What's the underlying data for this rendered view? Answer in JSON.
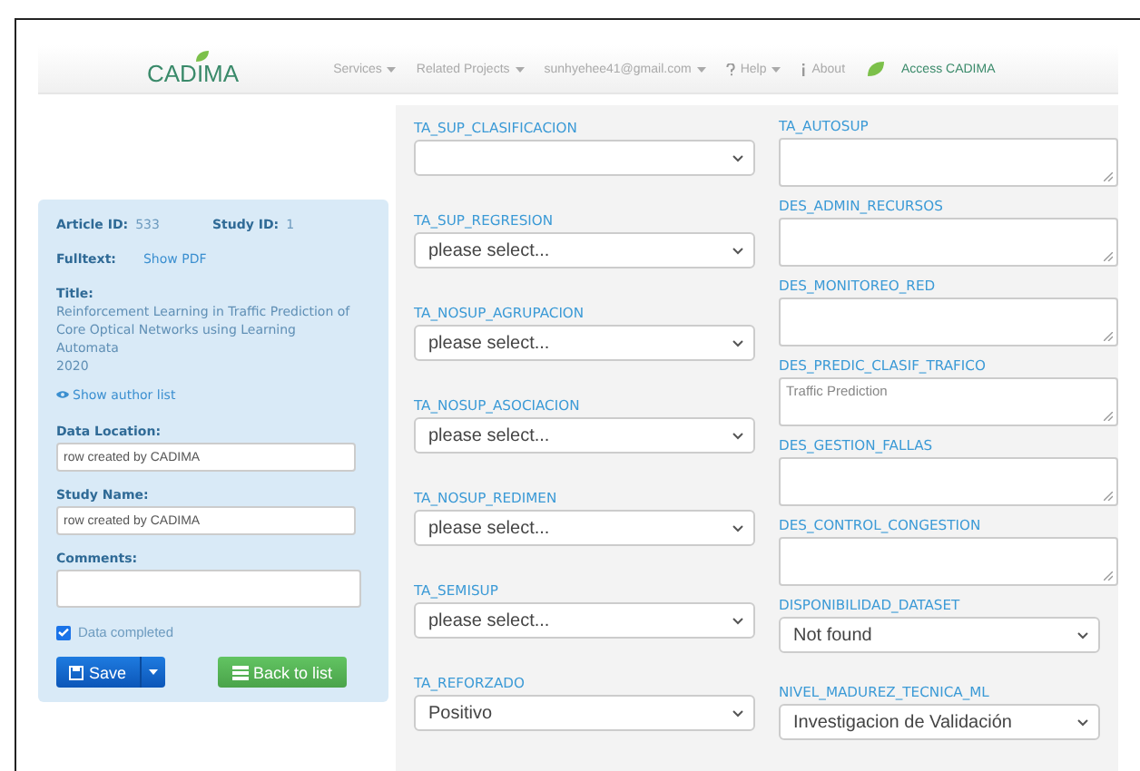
{
  "nav": {
    "brand": "CADIMA",
    "items": [
      {
        "label": "Services",
        "kind": "dropdown"
      },
      {
        "label": "Related Projects",
        "kind": "dropdown"
      },
      {
        "label": "sunhyehee41@gmail.com",
        "kind": "dropdown"
      },
      {
        "label": "Help",
        "kind": "help"
      },
      {
        "label": "About",
        "kind": "about"
      },
      {
        "label": "Access CADIMA",
        "kind": "access"
      }
    ]
  },
  "article": {
    "article_id_label": "Article ID:",
    "article_id": "533",
    "study_id_label": "Study ID:",
    "study_id": "1",
    "fulltext_label": "Fulltext:",
    "fulltext_link": "Show PDF",
    "title_label": "Title:",
    "title": "Reinforcement Learning in Traffic Prediction of Core Optical Networks using Learning Automata",
    "year": "2020",
    "author_link": "Show author list",
    "fields": [
      {
        "label": "Data Location:",
        "value": "row created by CADIMA",
        "kind": "input"
      },
      {
        "label": "Study Name:",
        "value": "row created by CADIMA",
        "kind": "input"
      },
      {
        "label": "Comments:",
        "kind": "textarea"
      }
    ],
    "data_completed": {
      "label": "Data completed",
      "checked": true
    },
    "buttons": [
      {
        "label": "Save",
        "kind": "save"
      },
      {
        "label": "Back to list",
        "kind": "back"
      }
    ]
  },
  "columns": [
    [
      {
        "label": "TA_SUP_CLASIFICACION",
        "kind": "select"
      },
      {
        "label": "TA_SUP_REGRESION",
        "kind": "select",
        "value": "please select..."
      },
      {
        "label": "TA_NOSUP_AGRUPACION",
        "kind": "select",
        "value": "please select..."
      },
      {
        "label": "TA_NOSUP_ASOCIACION",
        "kind": "select",
        "value": "please select..."
      },
      {
        "label": "TA_NOSUP_REDIMEN",
        "kind": "select",
        "value": "please select..."
      },
      {
        "label": "TA_SEMISUP",
        "kind": "select",
        "value": "please select..."
      },
      {
        "label": "TA_REFORZADO",
        "kind": "select",
        "value": "Positivo"
      }
    ],
    [
      {
        "label": "TA_AUTOSUP",
        "kind": "textarea"
      },
      {
        "label": "DES_ADMIN_RECURSOS",
        "kind": "textarea"
      },
      {
        "label": "DES_MONITOREO_RED",
        "kind": "textarea"
      },
      {
        "label": "DES_PREDIC_CLASIF_TRAFICO",
        "kind": "textarea",
        "value": "Traffic Prediction"
      },
      {
        "label": "DES_GESTION_FALLAS",
        "kind": "textarea"
      },
      {
        "label": "DES_CONTROL_CONGESTION",
        "kind": "textarea"
      },
      {
        "label": "DISPONIBILIDAD_DATASET",
        "kind": "select",
        "value": "Not found"
      },
      {
        "label": "NIVEL_MADUREZ_TECNICA_ML",
        "kind": "select",
        "value": "Investigacion de Validación"
      }
    ]
  ]
}
